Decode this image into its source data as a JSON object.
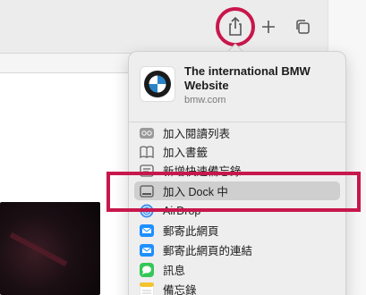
{
  "site": {
    "title": "The international BMW Website",
    "domain": "bmw.com"
  },
  "menu_items": [
    {
      "label": "加入閱讀列表",
      "icon": "reading-list-icon"
    },
    {
      "label": "加入書籤",
      "icon": "bookmarks-icon"
    },
    {
      "label": "新增快速備忘錄",
      "icon": "quick-note-icon"
    },
    {
      "label": "加入 Dock 中",
      "icon": "dock-icon",
      "selected": true
    },
    {
      "label": "AirDrop",
      "icon": "airdrop-icon"
    },
    {
      "label": "郵寄此網頁",
      "icon": "mail-icon"
    },
    {
      "label": "郵寄此網頁的連結",
      "icon": "mail-link-icon"
    },
    {
      "label": "訊息",
      "icon": "messages-icon"
    },
    {
      "label": "備忘錄",
      "icon": "notes-icon"
    }
  ],
  "colors": {
    "highlight": "#c8174c",
    "mail": "#1e8fff",
    "messages": "#34c759",
    "notes": "#f4c430"
  }
}
